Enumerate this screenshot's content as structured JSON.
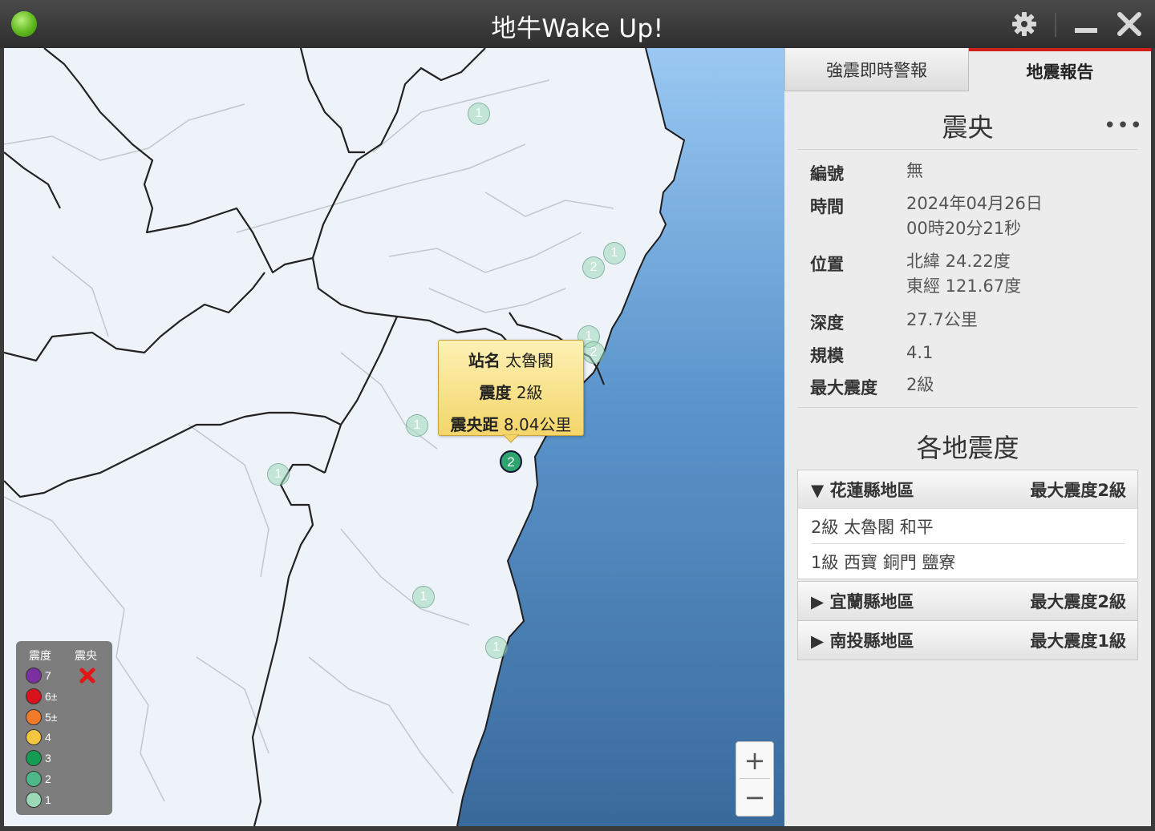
{
  "window": {
    "title": "地牛Wake Up!"
  },
  "tabs": [
    {
      "label": "強震即時警報",
      "active": false
    },
    {
      "label": "地震報告",
      "active": true
    }
  ],
  "report": {
    "section_title": "震央",
    "more_label": "•••",
    "rows": [
      {
        "label": "編號",
        "value": "無",
        "value2": ""
      },
      {
        "label": "時間",
        "value": "2024年04月26日",
        "value2": "00時20分21秒"
      },
      {
        "label": "位置",
        "value": "北緯 24.22度",
        "value2": "東經 121.67度"
      },
      {
        "label": "深度",
        "value": "27.7公里",
        "value2": ""
      },
      {
        "label": "規模",
        "value": "4.1",
        "value2": ""
      },
      {
        "label": "最大震度",
        "value": "2級",
        "value2": ""
      }
    ]
  },
  "regional": {
    "title": "各地震度",
    "regions": [
      {
        "name": "▼ 花蓮縣地區",
        "max": "最大震度2級",
        "expanded": true,
        "lines": [
          "2級  太魯閣 和平",
          "1級  西寶 銅門 鹽寮"
        ]
      },
      {
        "name": "▶ 宜蘭縣地區",
        "max": "最大震度2級",
        "expanded": false,
        "lines": []
      },
      {
        "name": "▶ 南投縣地區",
        "max": "最大震度1級",
        "expanded": false,
        "lines": []
      }
    ]
  },
  "tooltip": {
    "station_label": "站名",
    "station": "太魯閣",
    "intensity_label": "震度",
    "intensity": "2級",
    "distance_label": "震央距",
    "distance": "8.04公里"
  },
  "map": {
    "selected_station": {
      "intensity": "2"
    },
    "stations": [
      {
        "intensity": "1"
      },
      {
        "intensity": "2"
      },
      {
        "intensity": "1"
      },
      {
        "intensity": "1"
      },
      {
        "intensity": "2"
      },
      {
        "intensity": "1"
      },
      {
        "intensity": "1"
      },
      {
        "intensity": "1"
      },
      {
        "intensity": "1"
      }
    ]
  },
  "legend": {
    "intensity_header": "震度",
    "epicenter_header": "震央",
    "items": [
      {
        "label": "7",
        "color": "#7b2fa0"
      },
      {
        "label": "6±",
        "color": "#d9111b"
      },
      {
        "label": "5±",
        "color": "#f07a2a"
      },
      {
        "label": "4",
        "color": "#f3c642"
      },
      {
        "label": "3",
        "color": "#149c52"
      },
      {
        "label": "2",
        "color": "#4fb88a"
      },
      {
        "label": "1",
        "color": "#9ad8b8"
      }
    ]
  },
  "zoom": {
    "in_label": "+",
    "out_label": "−"
  },
  "colors": {
    "sea": "#5f95c8",
    "land": "#f3f6fb",
    "accent": "#d0201c"
  }
}
